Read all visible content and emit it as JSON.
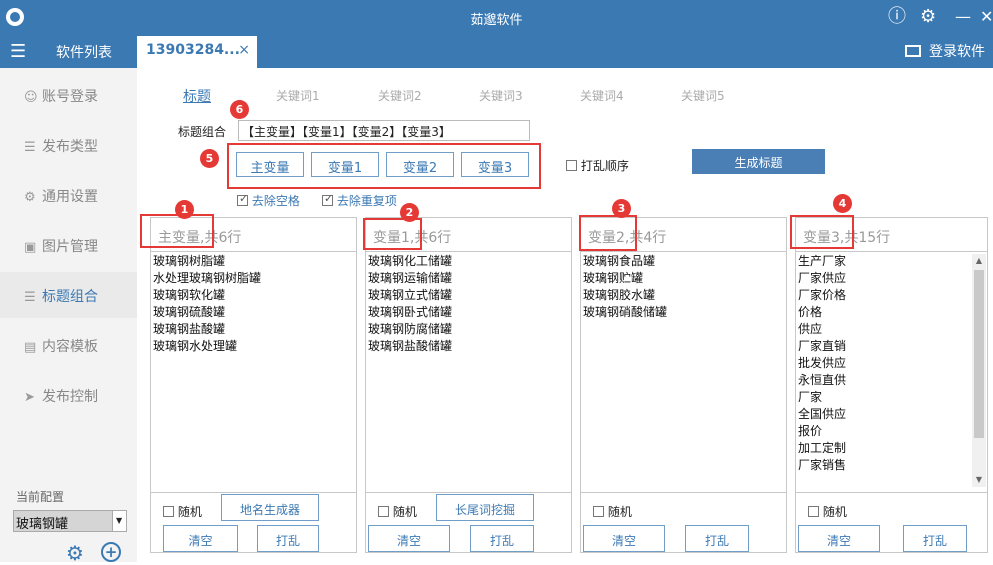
{
  "window": {
    "title": "茹邈软件"
  },
  "tabbar": {
    "software_list": "软件列表",
    "active_tab": "13903284...",
    "close": "×",
    "login_software": "登录软件"
  },
  "sidebar": {
    "items": [
      {
        "label": "账号登录",
        "icon": "user-icon"
      },
      {
        "label": "发布类型",
        "icon": "list-icon"
      },
      {
        "label": "通用设置",
        "icon": "gear-icon"
      },
      {
        "label": "图片管理",
        "icon": "image-icon"
      },
      {
        "label": "标题组合",
        "icon": "title-icon"
      },
      {
        "label": "内容模板",
        "icon": "document-icon"
      },
      {
        "label": "发布控制",
        "icon": "send-icon"
      }
    ],
    "current_config_label": "当前配置",
    "current_config_value": "玻璃钢罐"
  },
  "subtabs": [
    "标题",
    "关键词1",
    "关键词2",
    "关键词3",
    "关键词4",
    "关键词5"
  ],
  "title_combo": {
    "label": "标题组合",
    "value": "【主变量】【变量1】【变量2】【变量3】"
  },
  "var_buttons": [
    "主变量",
    "变量1",
    "变量2",
    "变量3"
  ],
  "shuffle_order": "打乱顺序",
  "generate_button": "生成标题",
  "remove_space": "去除空格",
  "remove_duplicate": "去除重复项",
  "panels": [
    {
      "header": "主变量,共6行",
      "items": [
        "玻璃钢树脂罐",
        "水处理玻璃钢树脂罐",
        "玻璃钢软化罐",
        "玻璃钢硫酸罐",
        "玻璃钢盐酸罐",
        "玻璃钢水处理罐"
      ],
      "random": "随机",
      "extra_button": "地名生成器",
      "clear": "清空",
      "shuffle": "打乱"
    },
    {
      "header": "变量1,共6行",
      "items": [
        "玻璃钢化工储罐",
        "玻璃钢运输储罐",
        "玻璃钢立式储罐",
        "玻璃钢卧式储罐",
        "玻璃钢防腐储罐",
        "玻璃钢盐酸储罐"
      ],
      "random": "随机",
      "extra_button": "长尾词挖掘",
      "clear": "清空",
      "shuffle": "打乱"
    },
    {
      "header": "变量2,共4行",
      "items": [
        "玻璃钢食品罐",
        "玻璃钢贮罐",
        "玻璃钢胶水罐",
        "玻璃钢硝酸储罐"
      ],
      "random": "随机",
      "clear": "清空",
      "shuffle": "打乱"
    },
    {
      "header": "变量3,共15行",
      "items": [
        "生产厂家",
        "厂家供应",
        "厂家价格",
        "价格",
        "供应",
        "厂家直销",
        "批发供应",
        "永恒直供",
        "厂家",
        "全国供应",
        "报价",
        "加工定制",
        "厂家销售"
      ],
      "random": "随机",
      "clear": "清空",
      "shuffle": "打乱"
    }
  ],
  "badges": [
    "1",
    "2",
    "3",
    "4",
    "5",
    "6"
  ]
}
